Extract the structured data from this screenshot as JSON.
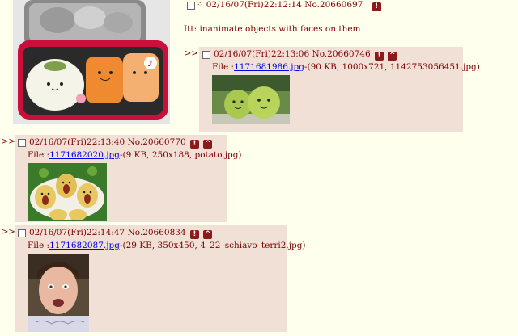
{
  "op": {
    "header_date": "02/16/07(Fri)22:12:14",
    "header_no": "No.20660697",
    "comment": "Itt: inanimate objects with faces on them"
  },
  "replies": [
    {
      "arrows": ">>",
      "date": "02/16/07(Fri)22:13:06",
      "no": "No.20660746",
      "file_label": "File :",
      "file_link": "1171681986.jpg",
      "file_meta": "-(90 KB, 1000x721, 1142753056451.jpg)"
    },
    {
      "arrows": ">>",
      "date": "02/16/07(Fri)22:13:40",
      "no": "No.20660770",
      "file_label": "File :",
      "file_link": "1171682020.jpg",
      "file_meta": "-(9 KB, 250x188, potato.jpg)"
    },
    {
      "arrows": ">>",
      "date": "02/16/07(Fri)22:14:47",
      "no": "No.20660834",
      "file_label": "File :",
      "file_link": "1171682087.jpg",
      "file_meta": "-(29 KB, 350x450, 4_22_schiavo_terri2.jpg)"
    }
  ],
  "icons": {
    "delete": "!",
    "up": "^"
  },
  "colors": {
    "background": "#ffffee",
    "reply_bg": "#f0e0d6",
    "text": "#800000",
    "link": "#0000ee",
    "button": "#8b1a1a"
  }
}
